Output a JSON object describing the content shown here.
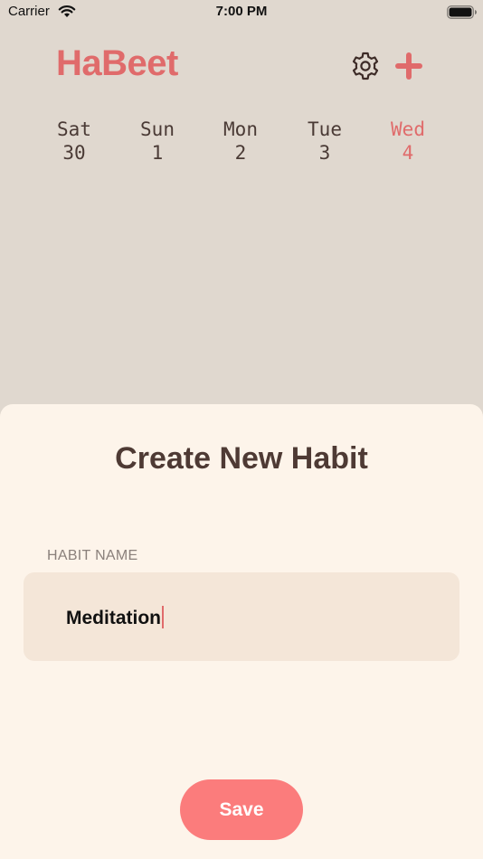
{
  "status_bar": {
    "carrier": "Carrier",
    "time": "7:00 PM"
  },
  "header": {
    "title": "HaBeet",
    "settings_icon": "gear-icon",
    "add_icon": "plus-icon",
    "accent_color": "#e06b6b"
  },
  "days": [
    {
      "name": "Sat",
      "num": "30",
      "active": false
    },
    {
      "name": "Sun",
      "num": "1",
      "active": false
    },
    {
      "name": "Mon",
      "num": "2",
      "active": false
    },
    {
      "name": "Tue",
      "num": "3",
      "active": false
    },
    {
      "name": "Wed",
      "num": "4",
      "active": true
    }
  ],
  "sheet": {
    "title": "Create New Habit",
    "field_label": "HABIT NAME",
    "field_value": "Meditation",
    "save_label": "Save"
  }
}
